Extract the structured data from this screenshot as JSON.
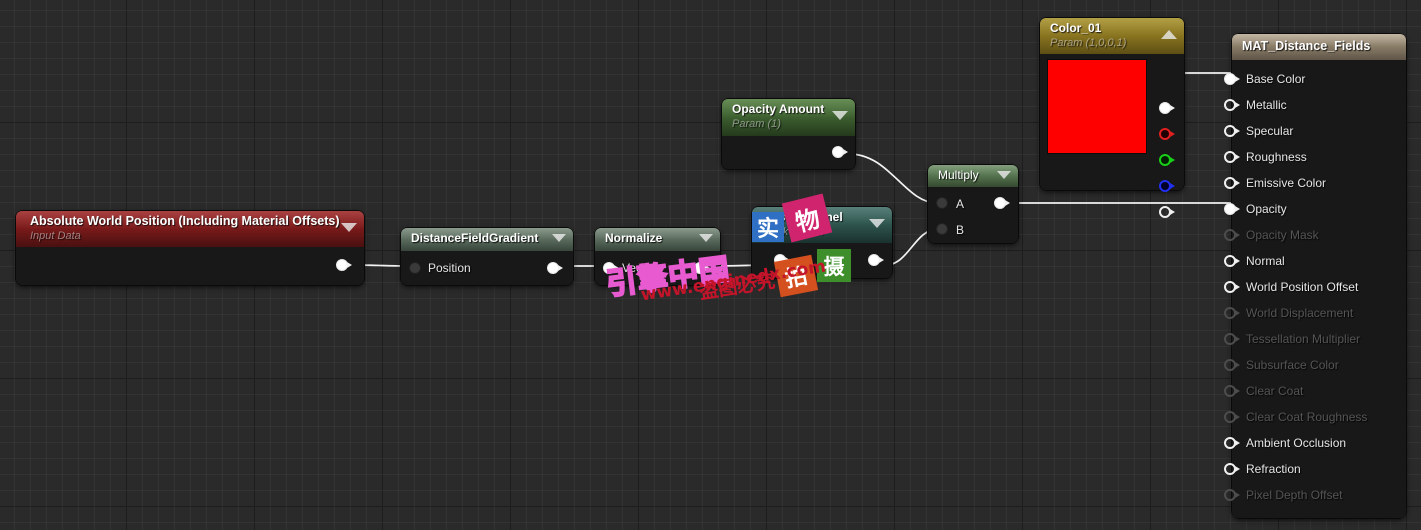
{
  "app": {
    "editor": "Unreal Engine Material Editor",
    "canvas_name": "material-graph-canvas"
  },
  "nodes": {
    "absolute_world_position": {
      "title": "Absolute World Position (Including Material Offsets)",
      "subtitle": "Input Data",
      "header_color": "#7a1a1a",
      "collapse_icon": "chevron-down-icon",
      "output_pin": "output"
    },
    "distance_field_gradient": {
      "title": "DistanceFieldGradient",
      "header_color": "#5a6b5d",
      "collapse_icon": "chevron-down-icon",
      "input_label": "Position"
    },
    "normalize": {
      "title": "Normalize",
      "header_color": "#5a6b5d",
      "collapse_icon": "chevron-down-icon",
      "input_label": "Vector"
    },
    "mask_channel": {
      "title": "Mask Channel",
      "subtitle": "Mask Param",
      "header_color": "#2e544e",
      "collapse_icon": "chevron-down-icon"
    },
    "opacity_amount": {
      "title": "Opacity Amount",
      "subtitle": "Param (1)",
      "header_color": "#3d6030",
      "collapse_icon": "chevron-down-icon"
    },
    "multiply": {
      "title": "Multiply",
      "header_color": "#55734f",
      "collapse_icon": "chevron-down-icon",
      "input_a": "A",
      "input_b": "B"
    },
    "color_01": {
      "title": "Color_01",
      "subtitle": "Param (1,0,0,1)",
      "header_color": "#8a7520",
      "collapse_icon": "chevron-up-icon",
      "swatch_color": "#ff0000",
      "pins": [
        {
          "name": "rgba",
          "color": "#ffffff",
          "state": "filled"
        },
        {
          "name": "r",
          "color": "#e02020",
          "state": "hollow"
        },
        {
          "name": "g",
          "color": "#18d018",
          "state": "hollow"
        },
        {
          "name": "b",
          "color": "#2030ee",
          "state": "hollow"
        },
        {
          "name": "a",
          "color": "#ffffff",
          "state": "hollow"
        }
      ]
    },
    "material_output": {
      "title": "MAT_Distance_Fields",
      "header_color": "#8c7f6a",
      "inputs": [
        {
          "label": "Base Color",
          "connected": true,
          "enabled": true
        },
        {
          "label": "Metallic",
          "connected": false,
          "enabled": true
        },
        {
          "label": "Specular",
          "connected": false,
          "enabled": true
        },
        {
          "label": "Roughness",
          "connected": false,
          "enabled": true
        },
        {
          "label": "Emissive Color",
          "connected": false,
          "enabled": true
        },
        {
          "label": "Opacity",
          "connected": true,
          "enabled": true
        },
        {
          "label": "Opacity Mask",
          "connected": false,
          "enabled": false
        },
        {
          "label": "Normal",
          "connected": false,
          "enabled": true
        },
        {
          "label": "World Position Offset",
          "connected": false,
          "enabled": true
        },
        {
          "label": "World Displacement",
          "connected": false,
          "enabled": false
        },
        {
          "label": "Tessellation Multiplier",
          "connected": false,
          "enabled": false
        },
        {
          "label": "Subsurface Color",
          "connected": false,
          "enabled": false
        },
        {
          "label": "Clear Coat",
          "connected": false,
          "enabled": false
        },
        {
          "label": "Clear Coat Roughness",
          "connected": false,
          "enabled": false
        },
        {
          "label": "Ambient Occlusion",
          "connected": false,
          "enabled": true
        },
        {
          "label": "Refraction",
          "connected": false,
          "enabled": true
        },
        {
          "label": "Pixel Depth Offset",
          "connected": false,
          "enabled": false
        }
      ]
    }
  },
  "watermarks": {
    "block_shi": "实",
    "block_wu": "物",
    "block_pai": "拍",
    "block_she": "摄",
    "engine_cn": "引擎中国",
    "url": "www.enginedx.com",
    "notice": "盗图必究"
  }
}
